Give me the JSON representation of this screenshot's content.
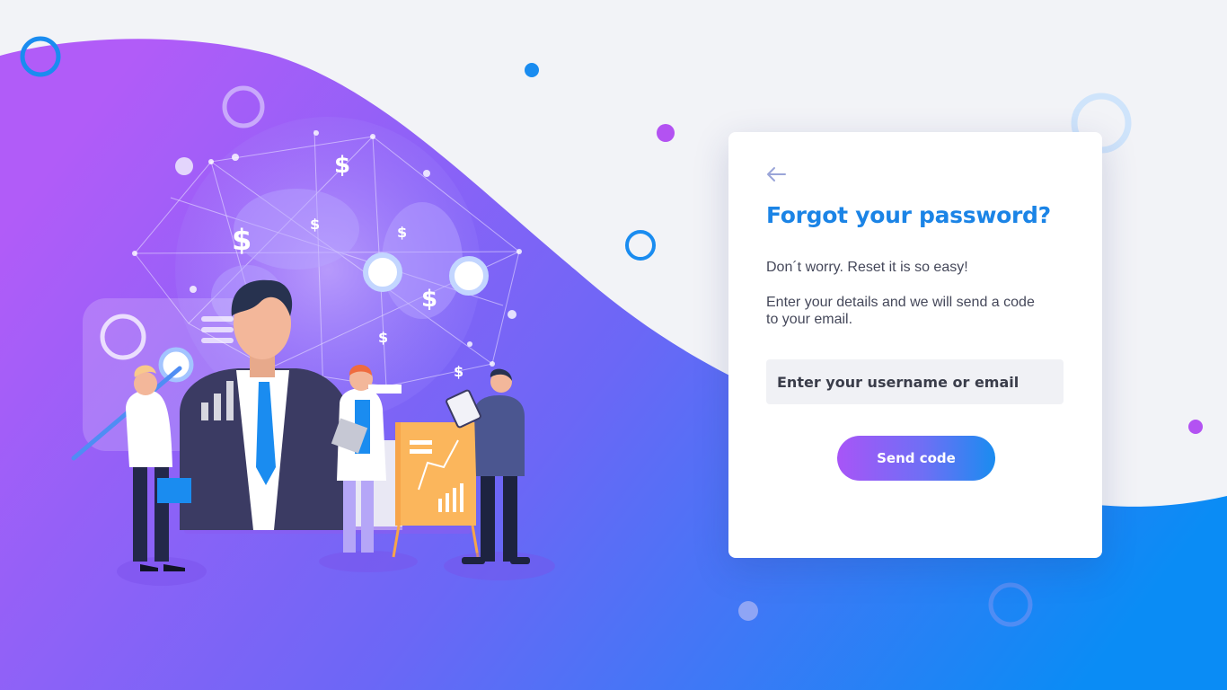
{
  "card": {
    "back_icon": "arrow-left-icon",
    "title": "Forgot your password?",
    "subtitle": "Don´t worry. Reset it is so easy!",
    "description": "Enter your details and we will send a code to your email.",
    "email_input": {
      "value": "",
      "placeholder": "Enter your username or email"
    },
    "send_button_label": "Send code"
  },
  "colors": {
    "brand_blue": "#1b84e6",
    "gradient_purple": "#a855f7",
    "gradient_blue": "#0a8cf5",
    "background": "#f2f3f7"
  },
  "illustration": {
    "icons": [
      "globe-icon",
      "dollar-icon",
      "bar-chart-icon",
      "presentation-board-icon",
      "businessman-icon"
    ]
  }
}
